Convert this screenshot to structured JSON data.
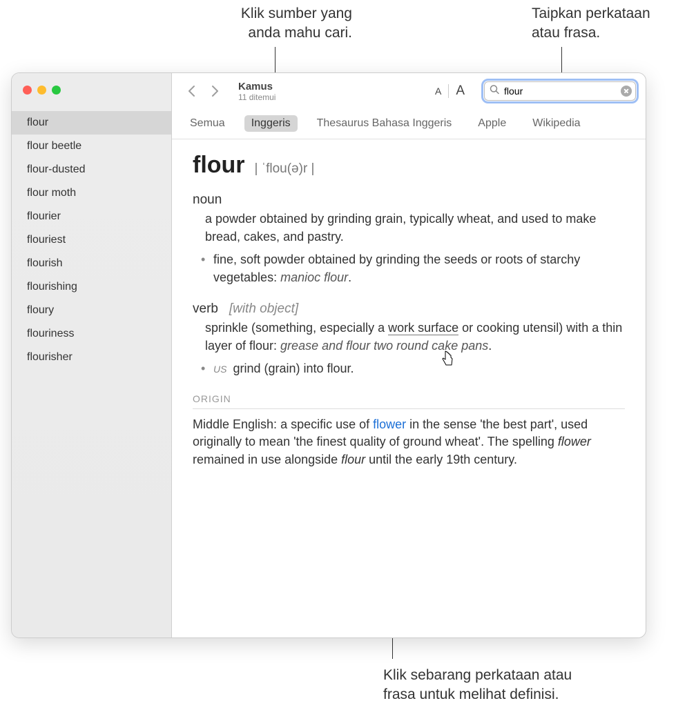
{
  "callouts": {
    "top_left": "Klik sumber yang\nanda mahu cari.",
    "top_right": "Taipkan perkataan\natau frasa.",
    "bottom": "Klik sebarang perkataan atau\nfrasa untuk melihat definisi."
  },
  "window": {
    "title": "Kamus",
    "subtitle": "11 ditemui"
  },
  "search": {
    "value": "flour"
  },
  "tabs": [
    "Semua",
    "Inggeris",
    "Thesaurus Bahasa Inggeris",
    "Apple",
    "Wikipedia"
  ],
  "active_tab_index": 1,
  "sidebar": {
    "items": [
      "flour",
      "flour beetle",
      "flour-dusted",
      "flour moth",
      "flourier",
      "flouriest",
      "flourish",
      "flourishing",
      "floury",
      "flouriness",
      "flourisher"
    ],
    "selected_index": 0
  },
  "entry": {
    "headword": "flour",
    "pronunciation": "| ˈflou(ə)r |",
    "senses": [
      {
        "pos": "noun",
        "pos_meta": "",
        "def": "a powder obtained by grinding grain, typically wheat, and used to make bread, cakes, and pastry.",
        "subdefs": [
          {
            "label": "",
            "text": "fine, soft powder obtained by grinding the seeds or roots of starchy vegetables: ",
            "example": "manioc flour",
            "trailing": "."
          }
        ]
      },
      {
        "pos": "verb",
        "pos_meta": "[with object]",
        "def_pre": "sprinkle (something, especially a ",
        "def_link": "work surface",
        "def_post": " or cooking utensil) with a thin layer of flour: ",
        "example": "grease and flour two round cake pans",
        "trailing": ".",
        "subdefs": [
          {
            "label": "US",
            "text": "grind (grain) into flour.",
            "example": "",
            "trailing": ""
          }
        ]
      }
    ],
    "origin": {
      "header": "ORIGIN",
      "pre": "Middle English: a specific use of ",
      "link": "flower",
      "mid": " in the sense 'the best part', used originally to mean 'the finest quality of ground wheat'. The spelling ",
      "ital": "flower",
      "post1": " remained in use alongside ",
      "ital2": "flour",
      "post2": " until the early 19th century."
    }
  }
}
